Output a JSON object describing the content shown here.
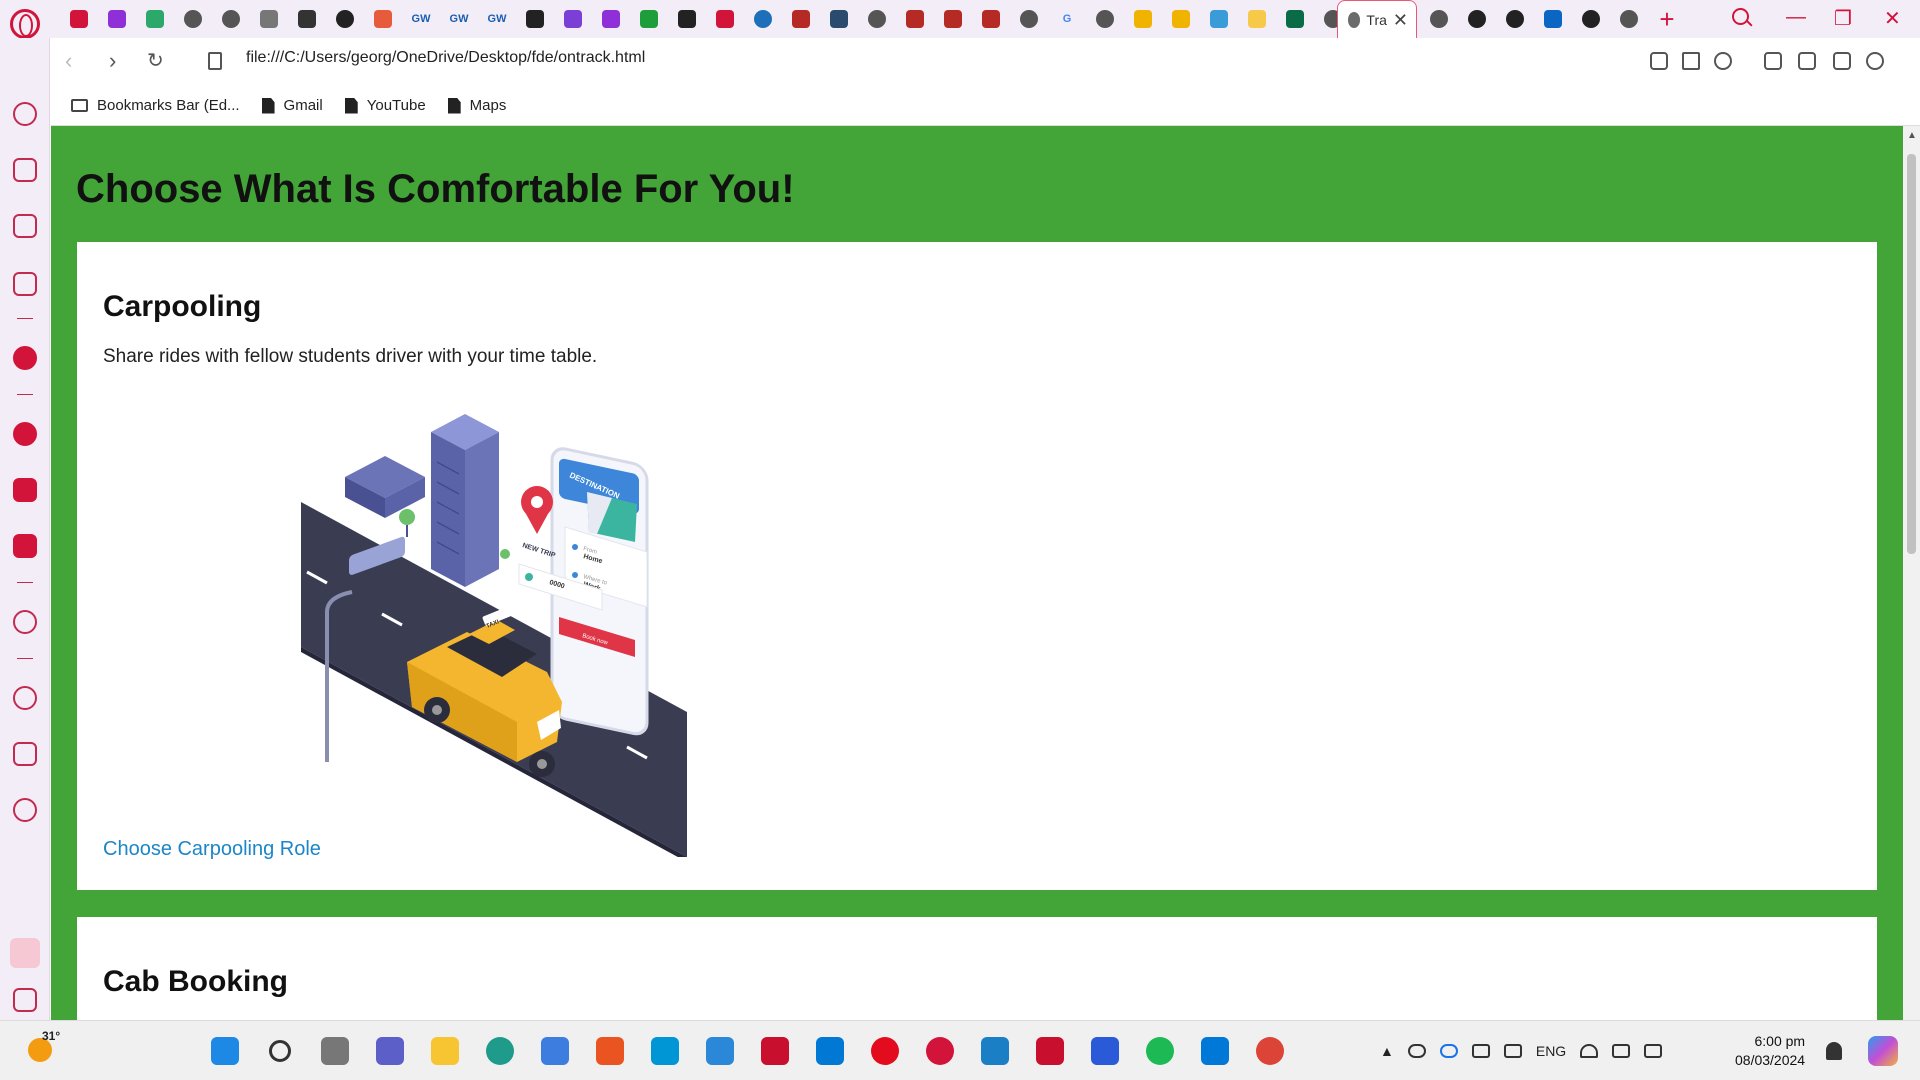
{
  "browser": {
    "active_tab": {
      "title": "Tra",
      "close_symbol": "✕"
    },
    "new_tab_symbol": "+",
    "window_controls": {
      "minimize": "—",
      "maximize": "❐",
      "close": "✕"
    },
    "favicons": [
      {
        "name": "gamepad-icon",
        "color": "#d2143a"
      },
      {
        "name": "lock-app-icon",
        "color": "#8e2fd8"
      },
      {
        "name": "green-app-icon",
        "color": "#2ba86a"
      },
      {
        "name": "globe-icon",
        "color": "#555555"
      },
      {
        "name": "globe-icon",
        "color": "#555555"
      },
      {
        "name": "cat-icon",
        "color": "#777777"
      },
      {
        "name": "mickey-icon",
        "color": "#333333"
      },
      {
        "name": "github-icon",
        "color": "#222222"
      },
      {
        "name": "calendar-icon",
        "color": "#e55b3c"
      },
      {
        "name": "gw-icon",
        "color": "#1a5fb4",
        "text": "GW"
      },
      {
        "name": "gw-icon",
        "color": "#1a5fb4",
        "text": "GW"
      },
      {
        "name": "gw-icon",
        "color": "#1a5fb4",
        "text": "GW"
      },
      {
        "name": "gear-icon",
        "color": "#222222"
      },
      {
        "name": "vs-icon",
        "color": "#7b3fd6"
      },
      {
        "name": "twitch-icon",
        "color": "#8e2fd8"
      },
      {
        "name": "grid-icon",
        "color": "#1d9e3a"
      },
      {
        "name": "mask-icon",
        "color": "#222222"
      },
      {
        "name": "opera-icon",
        "color": "#d2143a"
      },
      {
        "name": "world-icon",
        "color": "#1c6fb8"
      },
      {
        "name": "book-icon",
        "color": "#b52a25"
      },
      {
        "name": "screen-icon",
        "color": "#2a4b6e"
      },
      {
        "name": "globe-icon",
        "color": "#555555"
      },
      {
        "name": "book-icon",
        "color": "#b52a25"
      },
      {
        "name": "book-icon",
        "color": "#b52a25"
      },
      {
        "name": "book-icon",
        "color": "#b52a25"
      },
      {
        "name": "globe-icon",
        "color": "#555555"
      },
      {
        "name": "google-icon",
        "color": "#4285f4",
        "text": "G"
      },
      {
        "name": "globe-icon",
        "color": "#555555"
      },
      {
        "name": "m-icon",
        "color": "#f0b400"
      },
      {
        "name": "m-icon",
        "color": "#f0b400"
      },
      {
        "name": "chart-icon",
        "color": "#3a9bd9"
      },
      {
        "name": "note-icon",
        "color": "#f7c948"
      },
      {
        "name": "l-icon",
        "color": "#0a6b47"
      },
      {
        "name": "globe-icon",
        "color": "#555555"
      }
    ],
    "favicons_right": [
      {
        "name": "globe-icon",
        "color": "#555555"
      },
      {
        "name": "github-icon",
        "color": "#222222"
      },
      {
        "name": "github-icon",
        "color": "#222222"
      },
      {
        "name": "linkedin-icon",
        "color": "#0a66c2"
      },
      {
        "name": "github-icon",
        "color": "#222222"
      },
      {
        "name": "globe-icon",
        "color": "#555555"
      }
    ],
    "url": "file:///C:/Users/georg/OneDrive/Desktop/fde/ontrack.html",
    "bookmarks": [
      {
        "label": "Bookmarks Bar (Ed...",
        "type": "folder"
      },
      {
        "label": "Gmail",
        "type": "file"
      },
      {
        "label": "YouTube",
        "type": "file"
      },
      {
        "label": "Maps",
        "type": "file"
      }
    ]
  },
  "page": {
    "heading": "Choose What Is Comfortable For You!",
    "background_color": "#43a538",
    "carpooling": {
      "title": "Carpooling",
      "description": "Share rides with fellow students driver with your time table.",
      "link": "Choose Carpooling Role",
      "illustration": {
        "phone_header": "DESTINATION",
        "pin_label": "NEW TRIP",
        "from_label": "From",
        "from_value": "Home",
        "to_label": "Where to",
        "to_value": "Work",
        "card_number": "0000",
        "button": "Book now",
        "taxi_sign": "TAXI"
      }
    },
    "cab_booking": {
      "title": "Cab Booking"
    }
  },
  "taskbar": {
    "weather_temp": "31°",
    "apps": [
      {
        "name": "windows-start-icon",
        "color": "#1e88e5"
      },
      {
        "name": "search-icon",
        "color": "#333333"
      },
      {
        "name": "task-view-icon",
        "color": "#777777"
      },
      {
        "name": "teams-icon",
        "color": "#5b5fc7"
      },
      {
        "name": "file-explorer-icon",
        "color": "#f7c531"
      },
      {
        "name": "edge-icon",
        "color": "#1e9b8a"
      },
      {
        "name": "store-icon",
        "color": "#3d7de0"
      },
      {
        "name": "ubuntu-icon",
        "color": "#e95420"
      },
      {
        "name": "myhp-icon",
        "color": "#0096d6"
      },
      {
        "name": "help-icon",
        "color": "#2b88d8"
      },
      {
        "name": "mcafee-icon",
        "color": "#c8102e"
      },
      {
        "name": "blue-app-icon",
        "color": "#0078d4"
      },
      {
        "name": "opera-icon",
        "color": "#e30c1e"
      },
      {
        "name": "opera-gx-icon",
        "color": "#d2143a"
      },
      {
        "name": "wave-app-icon",
        "color": "#1a7fc4"
      },
      {
        "name": "mcafee-icon",
        "color": "#c8102e"
      },
      {
        "name": "webex-icon",
        "color": "#2a5ad8"
      },
      {
        "name": "spotify-icon",
        "color": "#1db954"
      },
      {
        "name": "vscode-icon",
        "color": "#0078d7"
      },
      {
        "name": "chrome-icon",
        "color": "#db4437"
      }
    ],
    "language": "ENG",
    "time": "6:00 pm",
    "date": "08/03/2024"
  }
}
